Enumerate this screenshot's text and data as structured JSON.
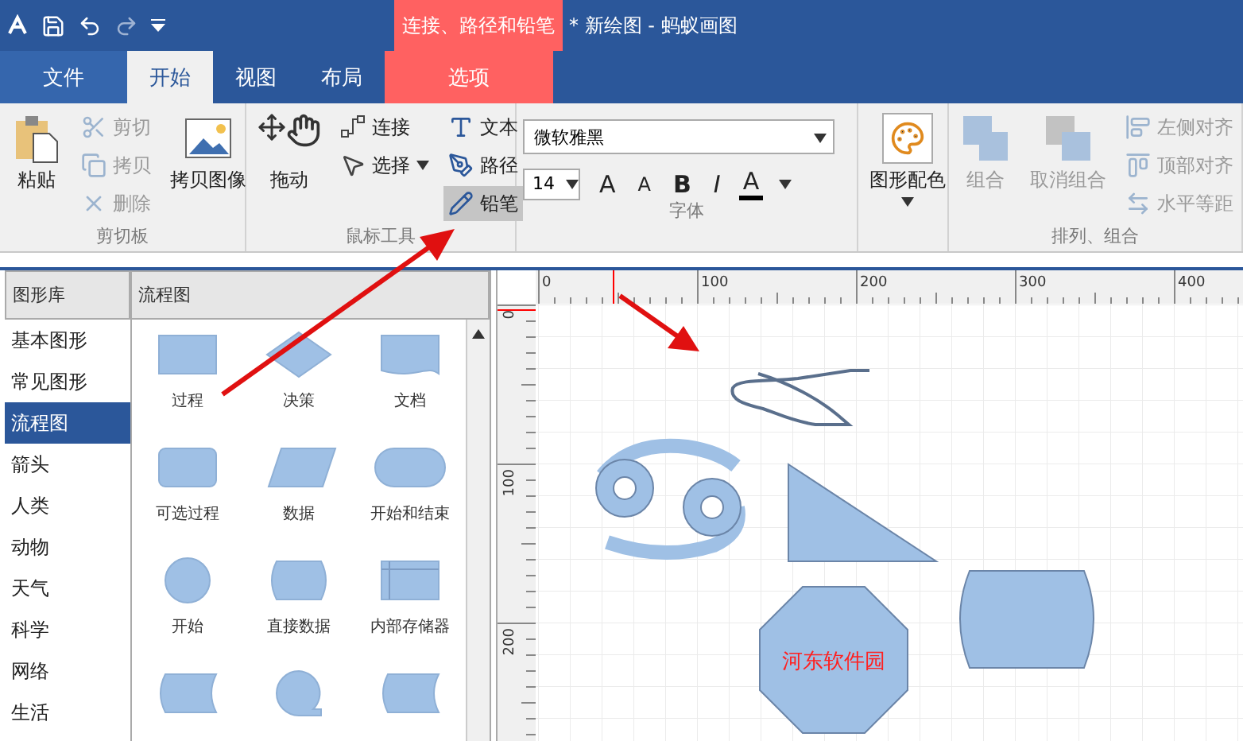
{
  "window": {
    "title": "* 新绘图 - 蚂蚁画图"
  },
  "contextual_group": {
    "label": "连接、路径和铅笔"
  },
  "tabs": [
    {
      "label": "文件",
      "kind": "file",
      "selected": false
    },
    {
      "label": "开始",
      "kind": "normal",
      "selected": true
    },
    {
      "label": "视图",
      "kind": "normal",
      "selected": false
    },
    {
      "label": "布局",
      "kind": "normal",
      "selected": false
    },
    {
      "label": "选项",
      "kind": "contextual",
      "selected": false
    }
  ],
  "ribbon": [
    {
      "label": "剪切板",
      "kind": "tools",
      "items": [
        {
          "label": "粘贴",
          "kind": "large",
          "disabled": false
        },
        {
          "label": "剪切",
          "kind": "small",
          "disabled": true
        },
        {
          "label": "拷贝",
          "kind": "small",
          "disabled": true
        },
        {
          "label": "删除",
          "kind": "small",
          "disabled": true
        },
        {
          "label": "拷贝图像",
          "kind": "large",
          "disabled": false
        }
      ]
    },
    {
      "label": "鼠标工具",
      "kind": "tools",
      "items": [
        {
          "label": "拖动",
          "kind": "large",
          "disabled": false,
          "selected": false
        },
        {
          "label": "连接",
          "kind": "small",
          "disabled": false,
          "selected": false
        },
        {
          "label": "选择",
          "kind": "small",
          "disabled": false,
          "selected": false,
          "dropdown": true
        },
        {
          "label": "文本",
          "kind": "small",
          "disabled": false,
          "selected": false
        },
        {
          "label": "路径",
          "kind": "small",
          "disabled": false,
          "selected": false
        },
        {
          "label": "铅笔",
          "kind": "small",
          "disabled": false,
          "selected": true
        }
      ]
    },
    {
      "label": "字体",
      "kind": "font",
      "font_name": "微软雅黑",
      "font_size": "14",
      "buttons": [
        {
          "label": "A",
          "kind": "grow"
        },
        {
          "label": "A",
          "kind": "shrink"
        },
        {
          "label": "B",
          "kind": "bold"
        },
        {
          "label": "I",
          "kind": "italic"
        },
        {
          "label": "A",
          "kind": "color"
        }
      ]
    },
    {
      "kind": "tools",
      "items": [
        {
          "label": "图形配色",
          "kind": "large",
          "disabled": false,
          "dropdown": true
        }
      ]
    },
    {
      "label": "排列、组合",
      "kind": "tools",
      "items": [
        {
          "label": "组合",
          "kind": "large",
          "disabled": true
        },
        {
          "label": "取消组合",
          "kind": "large",
          "disabled": true
        },
        {
          "label": "左侧对齐",
          "kind": "small",
          "disabled": true
        },
        {
          "label": "顶部对齐",
          "kind": "small",
          "disabled": true
        },
        {
          "label": "水平等距",
          "kind": "small",
          "disabled": true
        }
      ]
    }
  ],
  "library": {
    "columns": [
      "图形库",
      "流程图"
    ],
    "categories": [
      {
        "label": "基本图形",
        "selected": false
      },
      {
        "label": "常见图形",
        "selected": false
      },
      {
        "label": "流程图",
        "selected": true
      },
      {
        "label": "箭头",
        "selected": false
      },
      {
        "label": "人类",
        "selected": false
      },
      {
        "label": "动物",
        "selected": false
      },
      {
        "label": "天气",
        "selected": false
      },
      {
        "label": "科学",
        "selected": false
      },
      {
        "label": "网络",
        "selected": false
      },
      {
        "label": "生活",
        "selected": false
      }
    ],
    "shapes": [
      {
        "label": "过程",
        "kind": "rect"
      },
      {
        "label": "决策",
        "kind": "diamond"
      },
      {
        "label": "文档",
        "kind": "document"
      },
      {
        "label": "可选过程",
        "kind": "rounded"
      },
      {
        "label": "数据",
        "kind": "parallelogram"
      },
      {
        "label": "开始和结束",
        "kind": "terminator"
      },
      {
        "label": "开始",
        "kind": "circle"
      },
      {
        "label": "直接数据",
        "kind": "drum"
      },
      {
        "label": "内部存储器",
        "kind": "storage"
      },
      {
        "kind": "stored"
      },
      {
        "kind": "sequential"
      },
      {
        "kind": "stored"
      }
    ]
  },
  "canvas": {
    "top_ruler": [
      "0",
      "100",
      "200",
      "300",
      "400"
    ],
    "left_ruler": [
      "0",
      "100",
      "200"
    ],
    "shapes": [
      {
        "kind": "freehand"
      },
      {
        "kind": "cancer"
      },
      {
        "kind": "triangle"
      },
      {
        "kind": "octagon",
        "text": "河东软件园"
      },
      {
        "kind": "drum"
      }
    ]
  }
}
